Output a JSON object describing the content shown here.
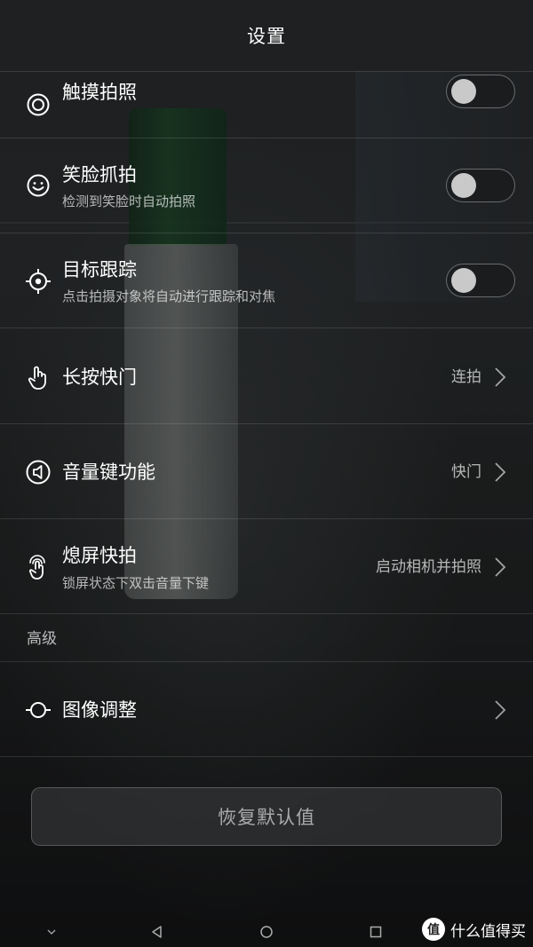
{
  "header": {
    "title": "设置"
  },
  "settings": {
    "touch_capture": {
      "label": "触摸拍照",
      "icon": "touch-capture-icon",
      "toggle_on": false
    },
    "smile_capture": {
      "label": "笑脸抓拍",
      "subtitle": "检测到笑脸时自动拍照",
      "icon": "smile-icon",
      "toggle_on": false
    },
    "object_tracking": {
      "label": "目标跟踪",
      "subtitle": "点击拍摄对象将自动进行跟踪和对焦",
      "icon": "target-icon",
      "toggle_on": false
    },
    "long_press_shutter": {
      "label": "长按快门",
      "value": "连拍",
      "icon": "hand-press-icon"
    },
    "volume_key": {
      "label": "音量键功能",
      "value": "快门",
      "icon": "volume-icon"
    },
    "screen_off_snap": {
      "label": "熄屏快拍",
      "subtitle": "锁屏状态下双击音量下键",
      "value": "启动相机并拍照",
      "icon": "double-tap-icon"
    }
  },
  "advanced": {
    "section_title": "高级",
    "image_adjust": {
      "label": "图像调整",
      "icon": "adjust-icon"
    }
  },
  "reset_button": {
    "label": "恢复默认值"
  },
  "watermark": {
    "text": "什么值得买",
    "logo_char": "值"
  },
  "colors": {
    "text_primary": "#ffffff",
    "text_secondary": "#b0b0b0",
    "toggle_knob": "#c9c9c9"
  }
}
